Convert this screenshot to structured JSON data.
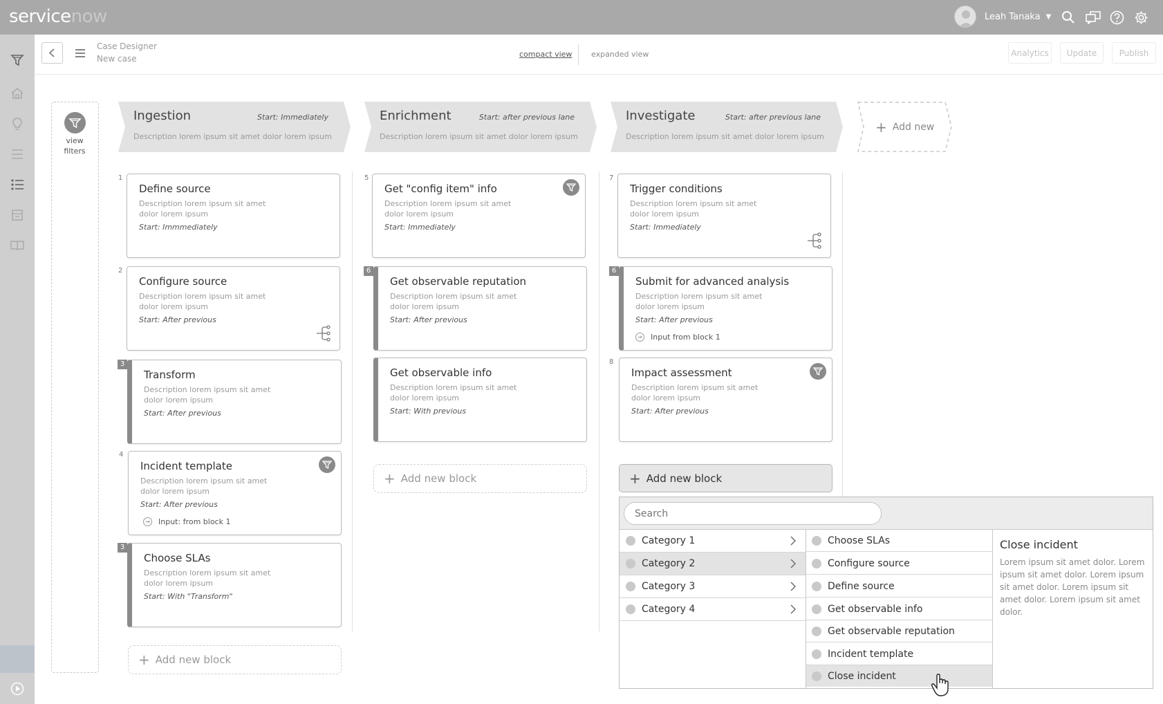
{
  "app": {
    "logo_main": "service",
    "logo_accent": "now"
  },
  "user": {
    "name": "Leah Tanaka",
    "caret": "▼"
  },
  "topbar_icons": [
    "search-icon",
    "chat-icon",
    "help-icon",
    "gear-icon"
  ],
  "sidebar_icons": [
    "filter-icon",
    "home-icon",
    "lightbulb-icon",
    "list-icon",
    "list-bullets-icon",
    "archive-icon",
    "book-icon",
    "play-icon"
  ],
  "header": {
    "title": "Case Designer",
    "subtitle": "New case",
    "compact_view": "compact view",
    "expanded_view": "expanded view",
    "analytics": "Analytics",
    "update": "Update",
    "publish": "Publish"
  },
  "filters": {
    "label": "view filters"
  },
  "lanes": [
    {
      "name": "Ingestion",
      "start": "Start: Immediately",
      "desc": "Description lorem ipsum sit amet dolor lorem ipsum"
    },
    {
      "name": "Enrichment",
      "start": "Start: after previous lane",
      "desc": "Description lorem ipsum sit amet dolor lorem ipsum"
    },
    {
      "name": "Investigate",
      "start": "Start: after previous lane",
      "desc": "Description lorem ipsum sit amet dolor lorem ipsum"
    }
  ],
  "add_lane": "Add new",
  "cards": [
    {
      "num": "1",
      "title": "Define source",
      "desc": "Description lorem ipsum sit amet dolor lorem ipsum",
      "start": "Start: Immmediately"
    },
    {
      "num": "2",
      "title": "Configure source",
      "desc": "Description lorem ipsum sit amet dolor lorem ipsum",
      "start": "Start: After previous"
    },
    {
      "num": "3",
      "title": "Transform",
      "desc": "Description lorem ipsum sit amet dolor lorem ipsum",
      "start": "Start: After previous"
    },
    {
      "num": "4",
      "title": "Incident template",
      "desc": "Description lorem ipsum sit amet dolor lorem ipsum",
      "start": "Start: After previous",
      "input": "Input: from block 1"
    },
    {
      "num": "3",
      "title": "Choose SLAs",
      "desc": "Description lorem ipsum sit amet dolor lorem ipsum",
      "start": "Start: With \"Transform\""
    },
    {
      "num": "5",
      "title": "Get \"config item\" info",
      "desc": "Description lorem ipsum sit amet dolor lorem ipsum",
      "start": "Start: Immediately"
    },
    {
      "num": "6",
      "title": "Get observable reputation",
      "desc": "Description lorem ipsum sit amet dolor lorem ipsum",
      "start": "Start: After previous"
    },
    {
      "num": "",
      "title": "Get observable info",
      "desc": "Description lorem ipsum sit amet dolor lorem ipsum",
      "start": "Start: With previous"
    },
    {
      "num": "7",
      "title": "Trigger conditions",
      "desc": "Description lorem ipsum sit amet dolor lorem ipsum",
      "start": "Start: Immediately"
    },
    {
      "num": "6",
      "title": "Submit for advanced analysis",
      "desc": "Description lorem ipsum sit amet dolor lorem ipsum",
      "start": "Start: After previous",
      "input": "Input from block 1"
    },
    {
      "num": "8",
      "title": "Impact assessment",
      "desc": "Description lorem ipsum sit amet dolor lorem ipsum",
      "start": "Start: After previous"
    }
  ],
  "add_block": "Add new block",
  "picker": {
    "search_placeholder": "Search",
    "categories": [
      "Category 1",
      "Category 2",
      "Category 3",
      "Category 4"
    ],
    "selected_category": "Category 2",
    "items": [
      "Choose SLAs",
      "Configure source",
      "Define source",
      "Get observable info",
      "Get observable reputation",
      "Incident template",
      "Close incident"
    ],
    "selected_item": "Close incident",
    "detail_title": "Close incident",
    "detail_text": "Lorem ipsum sit amet dolor. Lorem ipsum sit amet dolor. Lorem ipsum sit amet dolor. Lorem ipsum sit amet dolor. Lorem ipsum sit amet dolor."
  },
  "colors": {
    "topbar": "#a9a9a9",
    "sidebar": "#cfcfcf",
    "accent_gray": "#8a8a8a",
    "selected_row": "#e3e3e3"
  }
}
